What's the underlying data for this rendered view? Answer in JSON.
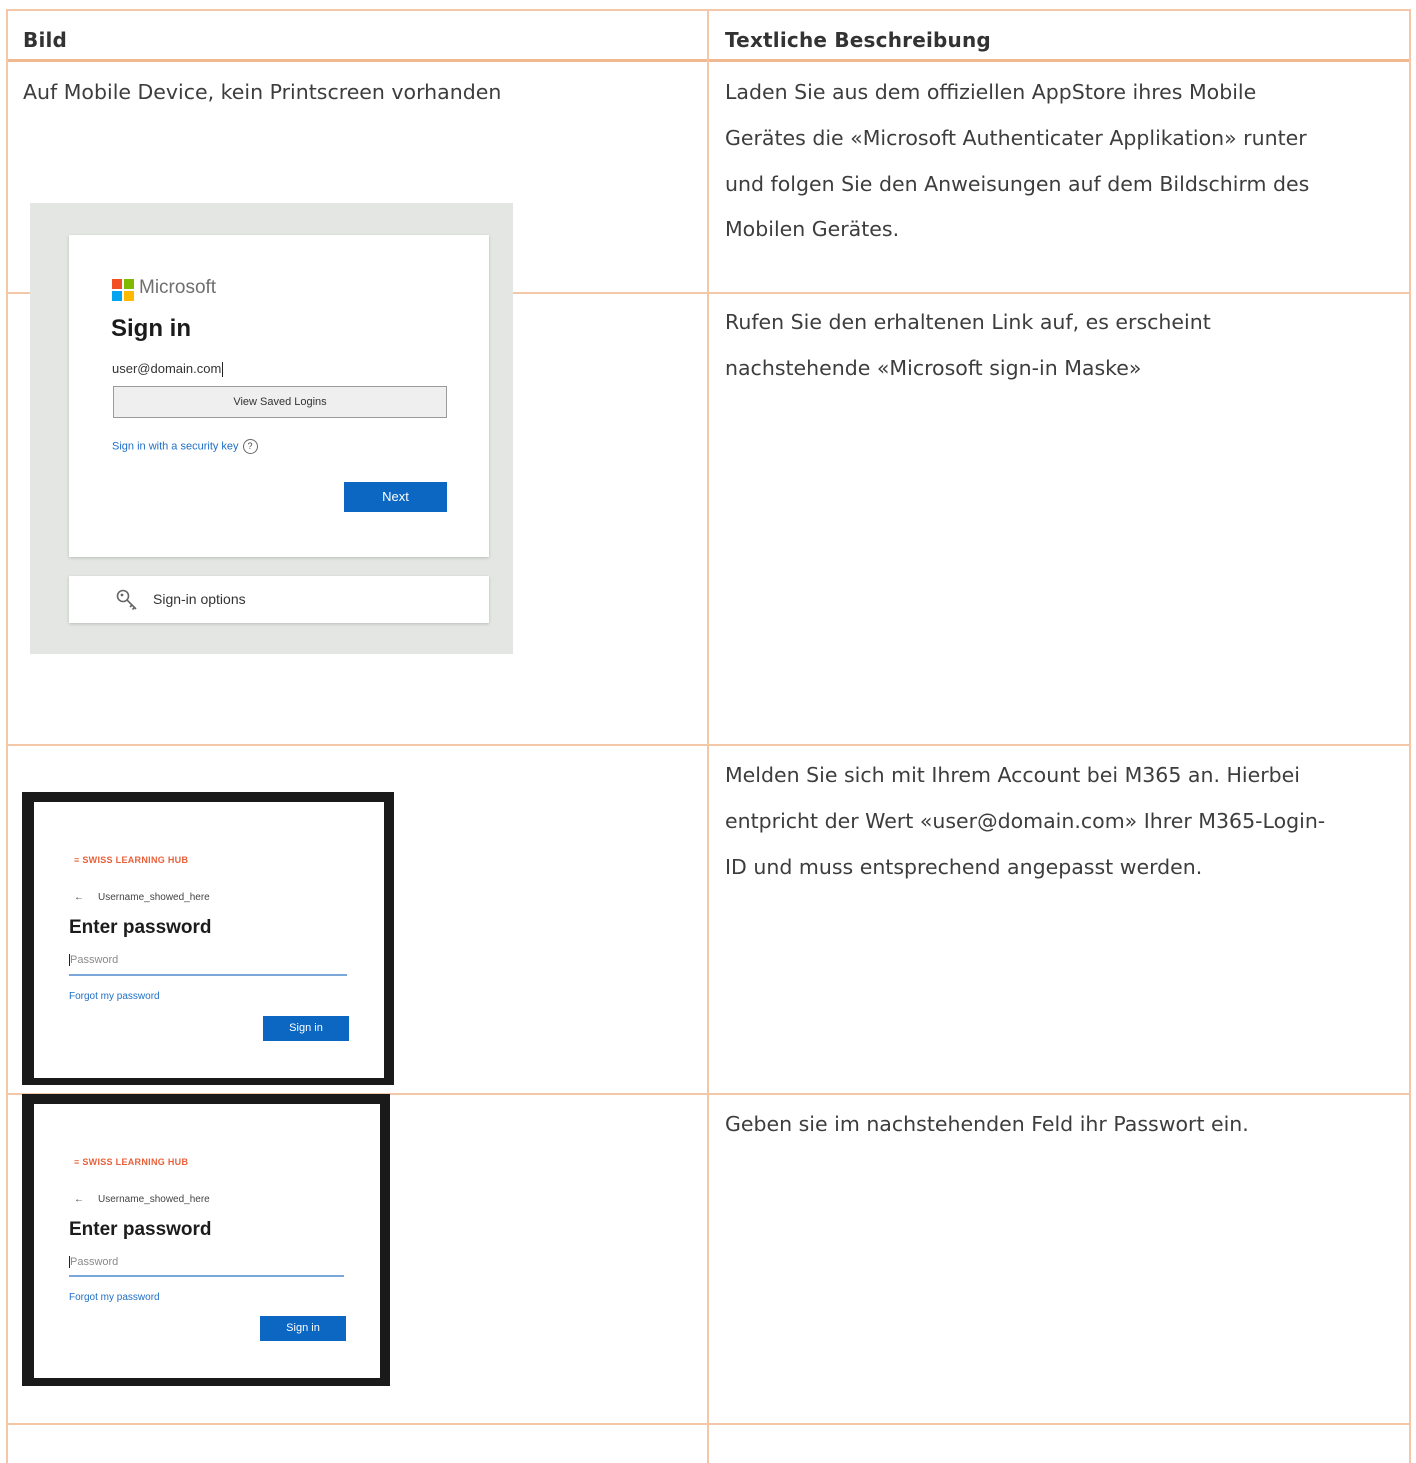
{
  "table": {
    "header": {
      "col1": "Bild",
      "col2": "Textliche Beschreibung"
    },
    "rows": [
      {
        "bild": "Auf Mobile Device, kein Printscreen vorhanden",
        "beschreibung_lines": [
          "Laden Sie aus dem offiziellen AppStore ihres Mobile",
          "Gerätes die «Microsoft Authenticater Applikation» runter",
          "und folgen Sie den Anweisungen auf dem Bildschirm des",
          "Mobilen Gerätes."
        ]
      },
      {
        "beschreibung_lines": [
          "Rufen Sie den erhaltenen Link auf, es erscheint",
          "nachstehende «Microsoft sign-in Maske»"
        ]
      },
      {
        "beschreibung_lines": [
          "Melden Sie sich mit Ihrem Account bei M365 an. Hierbei",
          "entpricht der Wert «user@domain.com» Ihrer M365-Login-",
          "ID und muss entsprechend angepasst werden."
        ]
      },
      {
        "beschreibung_lines": [
          "Geben sie im nachstehenden Feld ihr Passwort ein."
        ]
      }
    ]
  },
  "ms_signin": {
    "brand": "Microsoft",
    "title": "Sign in",
    "input_value": "user@domain.com",
    "saved_logins_button": "View Saved Logins",
    "security_key_link": "Sign in with a security key",
    "help_icon": "?",
    "next_button": "Next",
    "signin_options": "Sign-in options",
    "logo_colors": [
      "#f25022",
      "#7fba00",
      "#00a4ef",
      "#ffb900"
    ]
  },
  "pw_screen": {
    "brand": "≡ SWISS LEARNING HUB",
    "back_arrow": "←",
    "username": "Username_showed_here",
    "title": "Enter password",
    "placeholder": "Password",
    "forgot_link": "Forgot my password",
    "signin_button": "Sign in"
  }
}
